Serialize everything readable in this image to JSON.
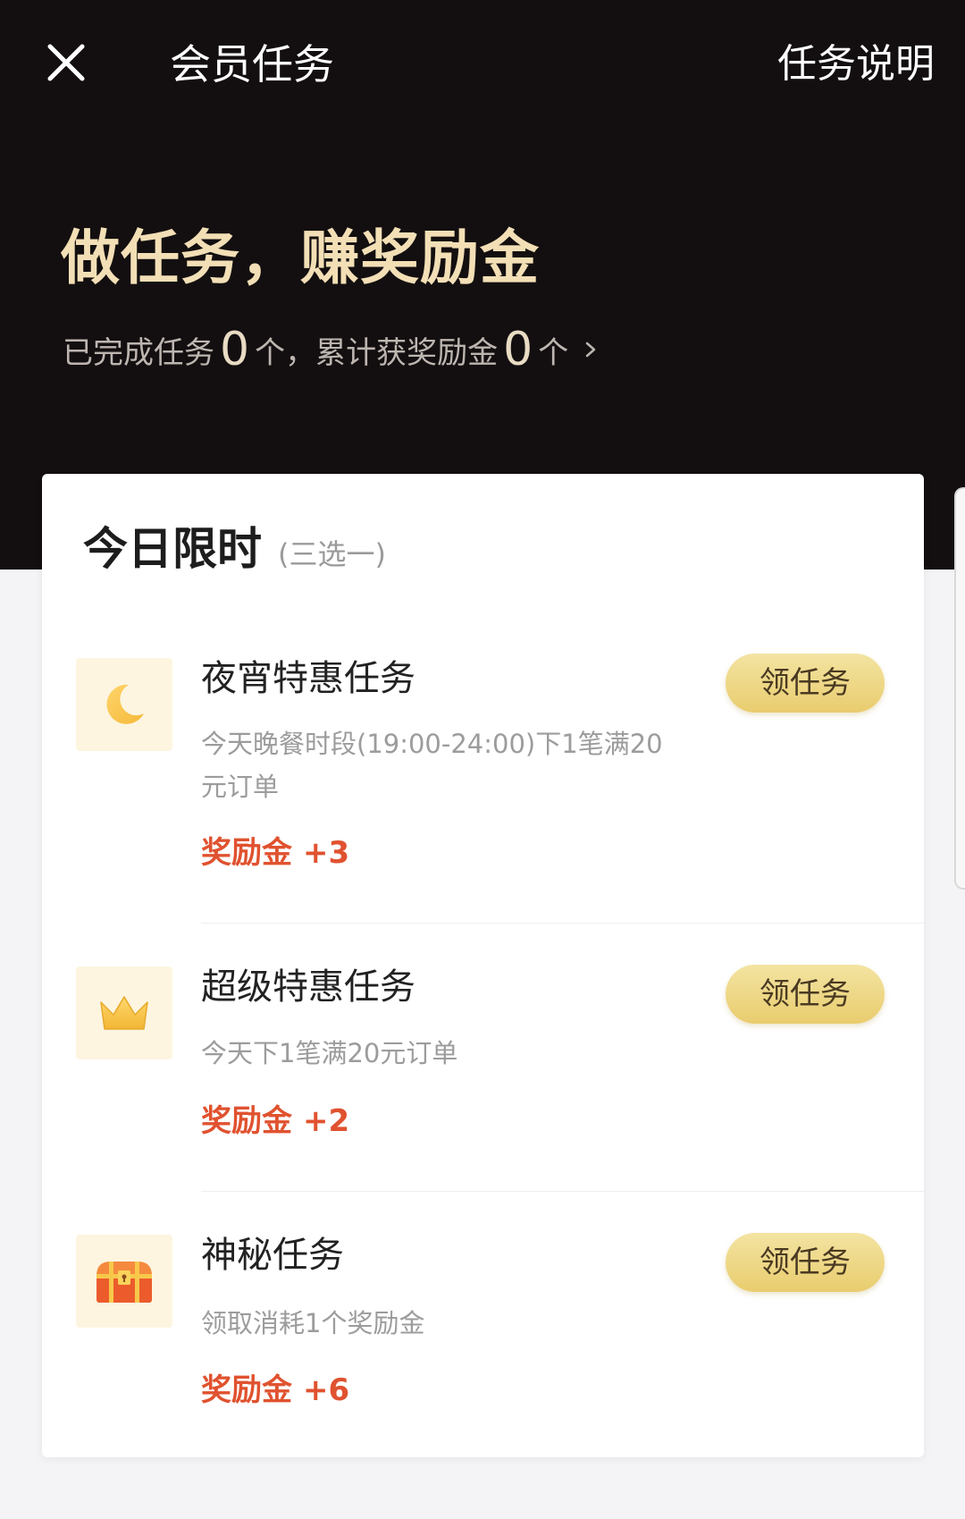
{
  "nav": {
    "title": "会员任务",
    "help_link": "任务说明"
  },
  "hero": {
    "title": "做任务，赚奖励金",
    "stats": {
      "prefix": "已完成任务",
      "tasks_done": "0",
      "mid": "个，累计获奖励金",
      "reward_total": "0",
      "suffix": "个"
    }
  },
  "section": {
    "title": "今日限时",
    "subtitle": "(三选一)"
  },
  "tasks": [
    {
      "icon": "moon-icon",
      "name": "夜宵特惠任务",
      "desc": "今天晚餐时段(19:00-24:00)下1笔满20元订单",
      "reward_label": "奖励金",
      "reward_value": "+3",
      "button": "领任务"
    },
    {
      "icon": "crown-icon",
      "name": "超级特惠任务",
      "desc": "今天下1笔满20元订单",
      "reward_label": "奖励金",
      "reward_value": "+2",
      "button": "领任务"
    },
    {
      "icon": "treasure-chest-icon",
      "name": "神秘任务",
      "desc": "领取消耗1个奖励金",
      "reward_label": "奖励金",
      "reward_value": "+6",
      "button": "领任务"
    }
  ],
  "colors": {
    "header_bg": "#130f10",
    "hero_gold": "#f3dfb6",
    "reward_red": "#e0522f",
    "button_gold": "#e9cc6e"
  }
}
